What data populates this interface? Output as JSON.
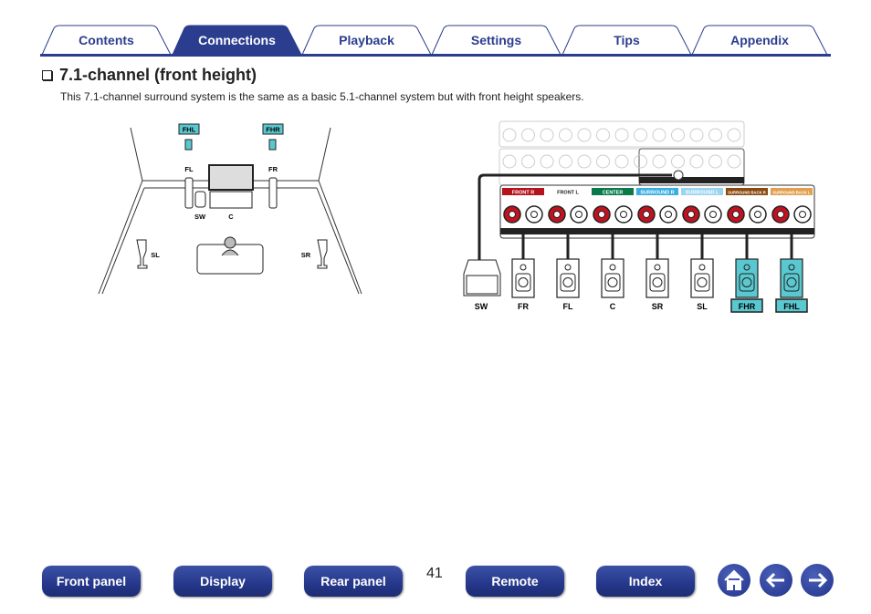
{
  "tabs": [
    {
      "label": "Contents",
      "active": false
    },
    {
      "label": "Connections",
      "active": true
    },
    {
      "label": "Playback",
      "active": false
    },
    {
      "label": "Settings",
      "active": false
    },
    {
      "label": "Tips",
      "active": false
    },
    {
      "label": "Appendix",
      "active": false
    }
  ],
  "section": {
    "title": "7.1-channel (front height)",
    "intro": "This 7.1-channel surround system is the same as a basic 5.1-channel system but with front height speakers."
  },
  "room_diagram": {
    "labels": {
      "fhl": "FHL",
      "fhr": "FHR",
      "fl": "FL",
      "fr": "FR",
      "sw": "SW",
      "c": "C",
      "sl": "SL",
      "sr": "SR"
    }
  },
  "connection_diagram": {
    "terminals": [
      {
        "label": "FRONT R",
        "color": "#b5121b"
      },
      {
        "label": "FRONT L",
        "color": "#ffffff"
      },
      {
        "label": "CENTER",
        "color": "#0a7a4a"
      },
      {
        "label": "SURROUND R",
        "color": "#3aaee0"
      },
      {
        "label": "SURROUND L",
        "color": "#9ad4ee"
      },
      {
        "label": "SURROUND BACK R",
        "color": "#8a4a12"
      },
      {
        "label": "SURROUND BACK L",
        "color": "#e0a050"
      }
    ],
    "speakers": [
      {
        "label": "FR",
        "highlight": false
      },
      {
        "label": "FL",
        "highlight": false
      },
      {
        "label": "C",
        "highlight": false
      },
      {
        "label": "SR",
        "highlight": false
      },
      {
        "label": "SL",
        "highlight": false
      },
      {
        "label": "FHR",
        "highlight": true
      },
      {
        "label": "FHL",
        "highlight": true
      }
    ],
    "subwoofer_label": "SW",
    "highlight_color": "#5ac8d0"
  },
  "footer": {
    "buttons": [
      "Front panel",
      "Display",
      "Rear panel",
      "Remote",
      "Index"
    ],
    "page_number": "41",
    "icons": [
      "home-icon",
      "back-arrow-icon",
      "forward-arrow-icon"
    ]
  },
  "colors": {
    "brand": "#2b3d8f"
  }
}
